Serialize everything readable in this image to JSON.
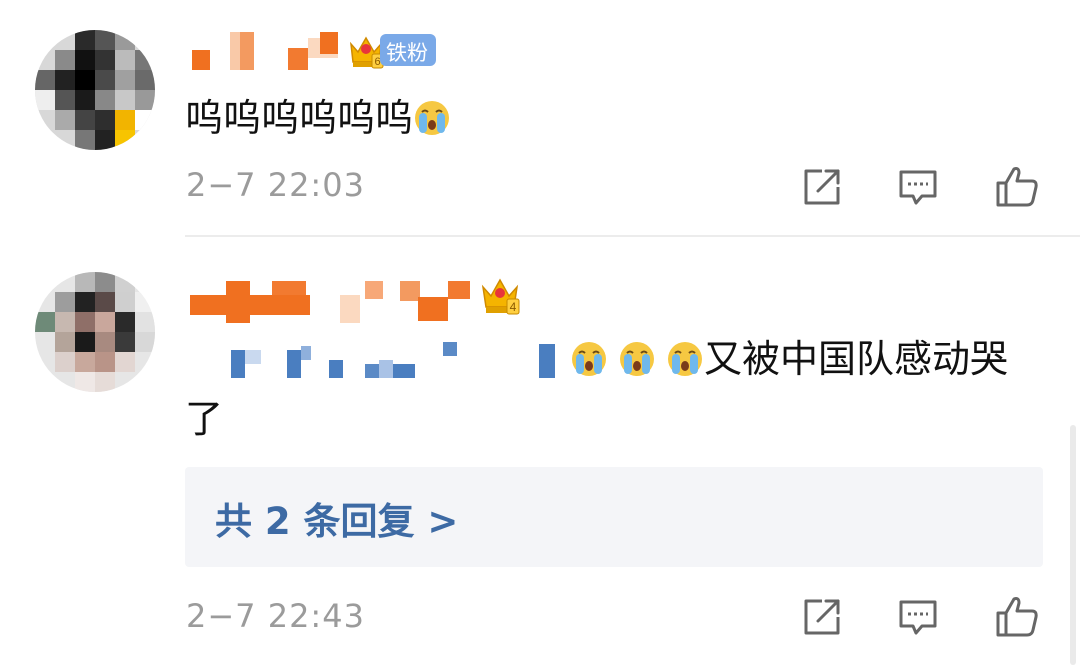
{
  "comments": [
    {
      "badge_label": "铁粉",
      "badge_level": "6",
      "text": "呜呜呜呜呜呜",
      "time": "2−7 22:03"
    },
    {
      "badge_level": "4",
      "text_line1": "又被中国队感动哭",
      "text_line2": "了",
      "replies_label": "共 2 条回复 >",
      "time": "2−7 22:43"
    }
  ],
  "icons": {
    "share": "share-icon",
    "comment": "comment-icon",
    "like": "thumbs-up-icon",
    "crying_emoji": "crying-emoji-icon",
    "crown": "crown-badge-icon"
  },
  "colors": {
    "reply_link": "#3d6aa4",
    "time": "#9b9b9b",
    "username_redacted": "#f07020",
    "mention_redacted": "#4a7ec0"
  }
}
